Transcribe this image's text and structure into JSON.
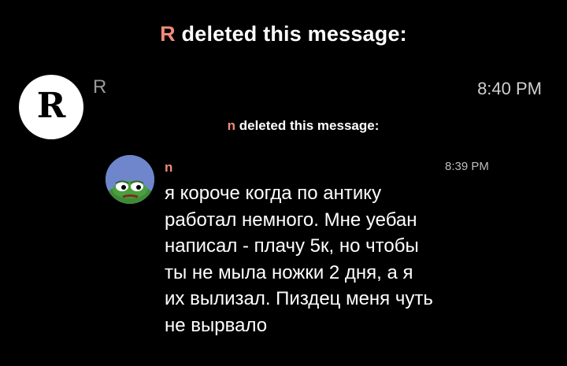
{
  "header": {
    "sender_initial": "R",
    "deleted_text": " deleted this message:"
  },
  "quoted_message": {
    "avatar_letter": "R",
    "sender": "R",
    "time": "8:40 PM",
    "deleted_notice": {
      "sender_initial": "n",
      "deleted_text": " deleted this message:"
    }
  },
  "nested_message": {
    "sender": "n",
    "time": "8:39 PM",
    "lines": [
      "я короче когда по антику",
      "работал немного. Мне уебан",
      "написал - плачу 5к, но чтобы",
      "ты не мыла ножки 2 дня, а я",
      "их вылизал. Пиздец меня чуть",
      "не вырвало"
    ]
  },
  "colors": {
    "background": "#000000",
    "name_accent": "#f08a7a",
    "muted_text": "#9a9a9a",
    "pepe_avatar_bg": "#6f86cc"
  },
  "icons": {
    "r_avatar": "gothic-letter-r-avatar",
    "n_avatar": "pepe-frog-avatar"
  }
}
